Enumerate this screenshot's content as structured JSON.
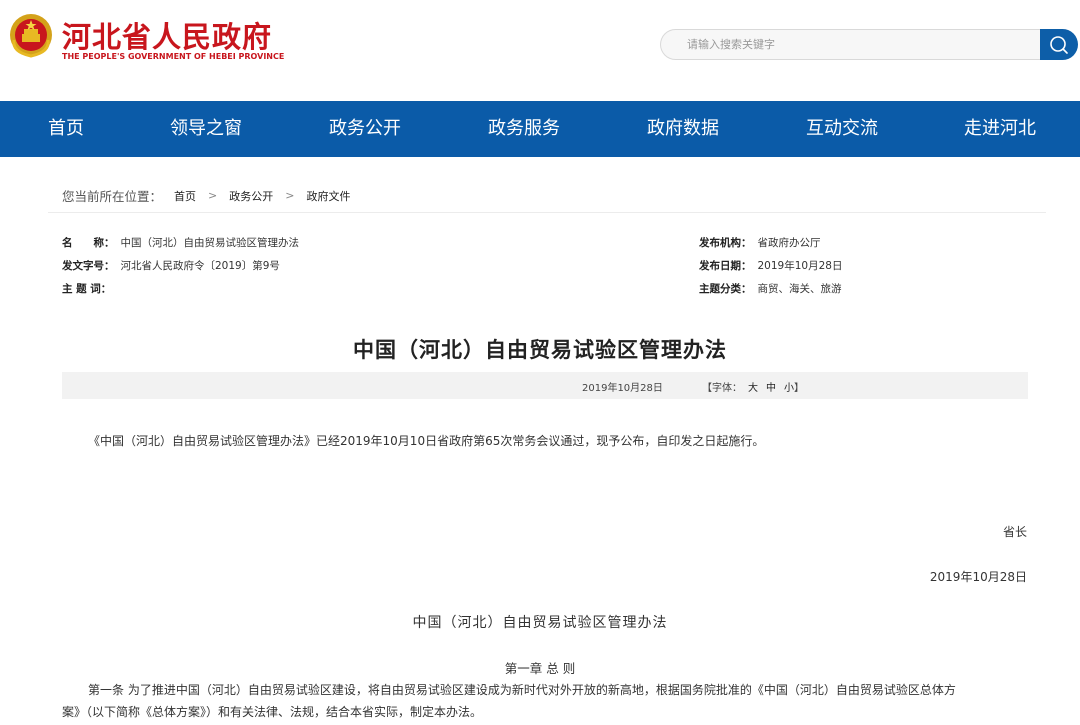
{
  "header": {
    "site_title": "河北省人民政府",
    "site_subtitle": "THE PEOPLE'S GOVERNMENT OF HEBEI PROVINCE",
    "search_placeholder": "请输入搜索关键字",
    "brand_color": "#c8161d",
    "emblem_icon": "national-emblem-icon",
    "search_icon": "search-icon"
  },
  "nav": {
    "items": [
      "首页",
      "领导之窗",
      "政务公开",
      "政务服务",
      "政府数据",
      "互动交流",
      "走进河北"
    ],
    "bg_color": "#0b5ba8"
  },
  "breadcrumb": {
    "prefix": "您当前所在位置：",
    "items": [
      "首页",
      "政务公开",
      "政府文件"
    ]
  },
  "meta": {
    "name_label": "名　　称：",
    "name_value": "中国（河北）自由贸易试验区管理办法",
    "doc_no_label": "发文字号：",
    "doc_no_value": "河北省人民政府令〔2019〕第9号",
    "keywords_label": "主 题 词：",
    "keywords_value": "",
    "issuer_label": "发布机构：",
    "issuer_value": "省政府办公厅",
    "date_label": "发布日期：",
    "date_value": "2019年10月28日",
    "category_label": "主题分类：",
    "category_value": "商贸、海关、旅游"
  },
  "article": {
    "title": "中国（河北）自由贸易试验区管理办法",
    "pub_date": "2019年10月28日",
    "font_label_open": "【字体：",
    "font_sizes": [
      "大",
      "中",
      "小"
    ],
    "font_label_close": "】",
    "intro": "《中国（河北）自由贸易试验区管理办法》已经2019年10月10日省政府第65次常务会议通过，现予公布，自印发之日起施行。",
    "signer": "省长",
    "sign_date": "2019年10月28日",
    "subtitle": "中国（河北）自由贸易试验区管理办法",
    "chapter": "第一章 总 则",
    "article1_line1": "第一条 为了推进中国（河北）自由贸易试验区建设，将自由贸易试验区建设成为新时代对外开放的新高地，根据国务院批准的《中国（河北）自由贸易试验区总体方",
    "article1_line2": "案》（以下简称《总体方案》）和有关法律、法规，结合本省实际，制定本办法。"
  }
}
